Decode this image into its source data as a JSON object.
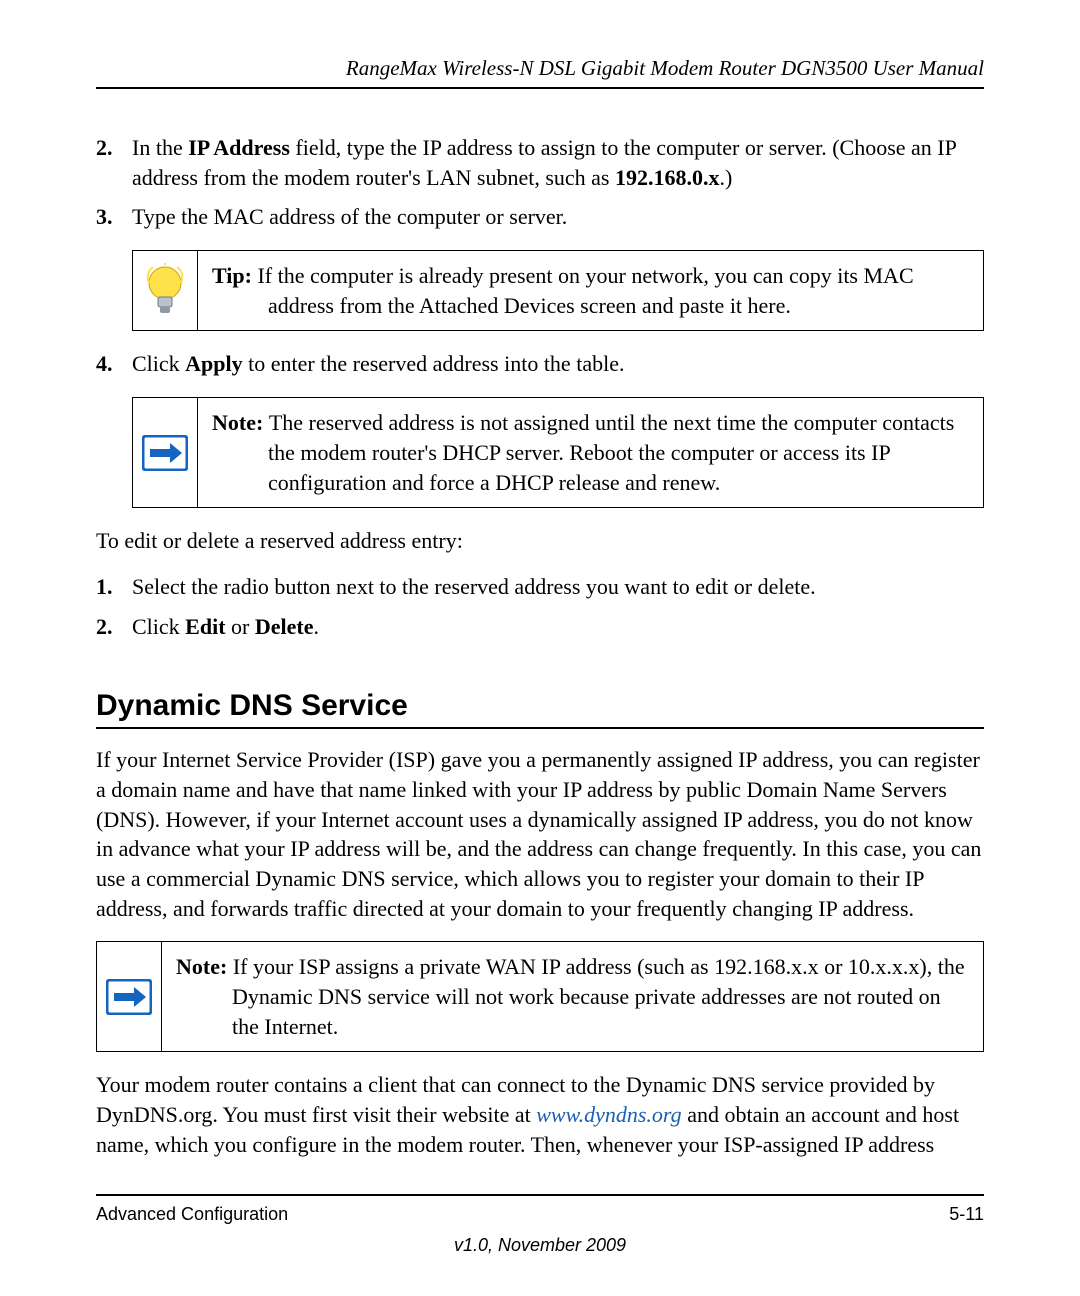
{
  "header": {
    "running": "RangeMax Wireless-N DSL Gigabit Modem Router DGN3500 User Manual"
  },
  "steps1": {
    "s2_num": "2.",
    "s2_a": "In the ",
    "s2_b": "IP Address",
    "s2_c": " field, type the IP address to assign to the computer or server. (Choose an IP address from the modem router's LAN subnet, such as ",
    "s2_d": "192.168.0.x",
    "s2_e": ".)",
    "s3_num": "3.",
    "s3": "Type the MAC address of the computer or server."
  },
  "tip": {
    "label": "Tip: ",
    "line1": "If the computer is already present on your network, you can copy its MAC",
    "line2": "address from the Attached Devices screen and paste it here."
  },
  "steps2": {
    "s4_num": "4.",
    "s4_a": "Click ",
    "s4_b": "Apply",
    "s4_c": " to enter the reserved address into the table."
  },
  "note1": {
    "label": "Note: ",
    "line1": "The reserved address is not assigned until the next time the computer contacts",
    "line2": "the modem router's DHCP server. Reboot the computer or access its IP configuration and force a DHCP release and renew."
  },
  "edit_intro": "To edit or delete a reserved address entry:",
  "edit_steps": {
    "s1_num": "1.",
    "s1": "Select the radio button next to the reserved address you want to edit or delete.",
    "s2_num": "2.",
    "s2_a": "Click ",
    "s2_b": "Edit",
    "s2_c": " or ",
    "s2_d": "Delete",
    "s2_e": "."
  },
  "section_heading": "Dynamic DNS Service",
  "dns_para": "If your Internet Service Provider (ISP) gave you a permanently assigned IP address, you can register a domain name and have that name linked with your IP address by public Domain Name Servers (DNS). However, if your Internet account uses a dynamically assigned IP address, you do not know in advance what your IP address will be, and the address can change frequently. In this case, you can use a commercial Dynamic DNS service, which allows you to register your domain to their IP address, and forwards traffic directed at your domain to your frequently changing IP address.",
  "note2": {
    "label": "Note: ",
    "line1": "If your ISP assigns a private WAN IP address (such as 192.168.x.x or 10.x.x.x), the",
    "line2": "Dynamic DNS service will not work because private addresses are not routed on the Internet."
  },
  "dns_para2_a": "Your modem router contains a client that can connect to the Dynamic DNS service provided by DynDNS.org. You must first visit their website at ",
  "dns_link": "www.dyndns.org",
  "dns_para2_b": " and obtain an account and host name, which you configure in the modem router. Then, whenever your ISP-assigned IP address",
  "footer": {
    "left": "Advanced Configuration",
    "right": "5-11",
    "version": "v1.0, November 2009"
  }
}
